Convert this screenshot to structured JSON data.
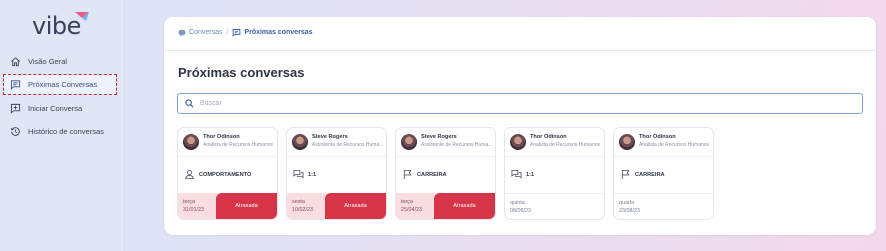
{
  "app": {
    "logo_text": "vibe"
  },
  "sidebar": {
    "items": [
      {
        "label": "Visão Geral",
        "icon": "home-icon"
      },
      {
        "label": "Próximas Conversas",
        "icon": "chat-icon",
        "active": true
      },
      {
        "label": "Iniciar Conversa",
        "icon": "add-chat-icon"
      },
      {
        "label": "Histórico de conversas",
        "icon": "history-icon"
      }
    ]
  },
  "breadcrumb": {
    "parent": "Conversas",
    "current": "Próximas conversas"
  },
  "page": {
    "title": "Próximas conversas"
  },
  "search": {
    "placeholder": "Buscar",
    "value": ""
  },
  "cards": [
    {
      "name": "Thor Odinson",
      "role": "Analista de Recursos Humanos",
      "type": "COMPORTAMENTO",
      "type_icon": "person-icon",
      "weekday": "terça",
      "date": "31/01/23",
      "status": "Atrasada",
      "late": true
    },
    {
      "name": "Steve Rogers",
      "role": "Assistente de Recursos Humanos",
      "type": "1:1",
      "type_icon": "chat-bubbles-icon",
      "weekday": "sexta",
      "date": "10/02/23",
      "status": "Atrasada",
      "late": true
    },
    {
      "name": "Steve Rogers",
      "role": "Assistente de Recursos Humanos",
      "type": "CARREIRA",
      "type_icon": "flag-icon",
      "weekday": "terça",
      "date": "25/04/23",
      "status": "Atrasada",
      "late": true
    },
    {
      "name": "Thor Odinson",
      "role": "Analista de Recursos Humanos",
      "type": "1:1",
      "type_icon": "chat-bubbles-icon",
      "weekday": "quinta",
      "date": "08/06/23",
      "status": "",
      "late": false
    },
    {
      "name": "Thor Odinson",
      "role": "Analista de Recursos Humanos",
      "type": "CARREIRA",
      "type_icon": "flag-icon",
      "weekday": "quarta",
      "date": "23/08/23",
      "status": "",
      "late": false
    }
  ],
  "colors": {
    "accent": "#d63548",
    "brand": "#3d5ea3",
    "logo_accent": "#e8608a"
  }
}
